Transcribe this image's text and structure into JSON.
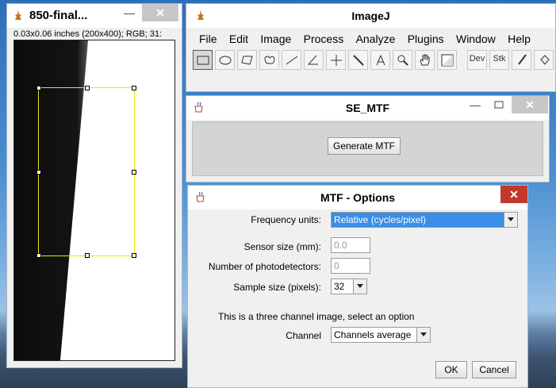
{
  "image_window": {
    "title": "850-final...",
    "info": "0.03x0.06 inches (200x400); RGB; 31:",
    "min_label": "—",
    "close_label": "✕"
  },
  "imagej": {
    "title": "ImageJ",
    "menu": [
      "File",
      "Edit",
      "Image",
      "Process",
      "Analyze",
      "Plugins",
      "Window",
      "Help"
    ],
    "tools": [
      "rectangle-tool",
      "oval-tool",
      "polygon-tool",
      "freehand-tool",
      "line-tool",
      "angle-tool",
      "point-tool",
      "wand-tool",
      "text-tool",
      "magnifier-tool",
      "hand-tool",
      "color-picker-tool",
      "dev-tool",
      "stk-tool",
      "brush-tool",
      "flood-fill-tool"
    ],
    "dev_label": "Dev",
    "stk_label": "Stk"
  },
  "se_mtf": {
    "title": "SE_MTF",
    "generate_label": "Generate MTF",
    "min_label": "—",
    "close_label": "✕"
  },
  "mtf_options": {
    "title": "MTF - Options",
    "close_label": "✕",
    "frequency_units_label": "Frequency units:",
    "frequency_units_value": "Relative (cycles/pixel)",
    "sensor_size_label": "Sensor size (mm):",
    "sensor_size_value": "0.0",
    "photodetectors_label": "Number of photodetectors:",
    "photodetectors_value": "0",
    "sample_size_label": "Sample size (pixels):",
    "sample_size_value": "32",
    "channel_message": "This is a three channel image, select an option",
    "channel_label": "Channel",
    "channel_value": "Channels average",
    "ok_label": "OK",
    "cancel_label": "Cancel"
  }
}
